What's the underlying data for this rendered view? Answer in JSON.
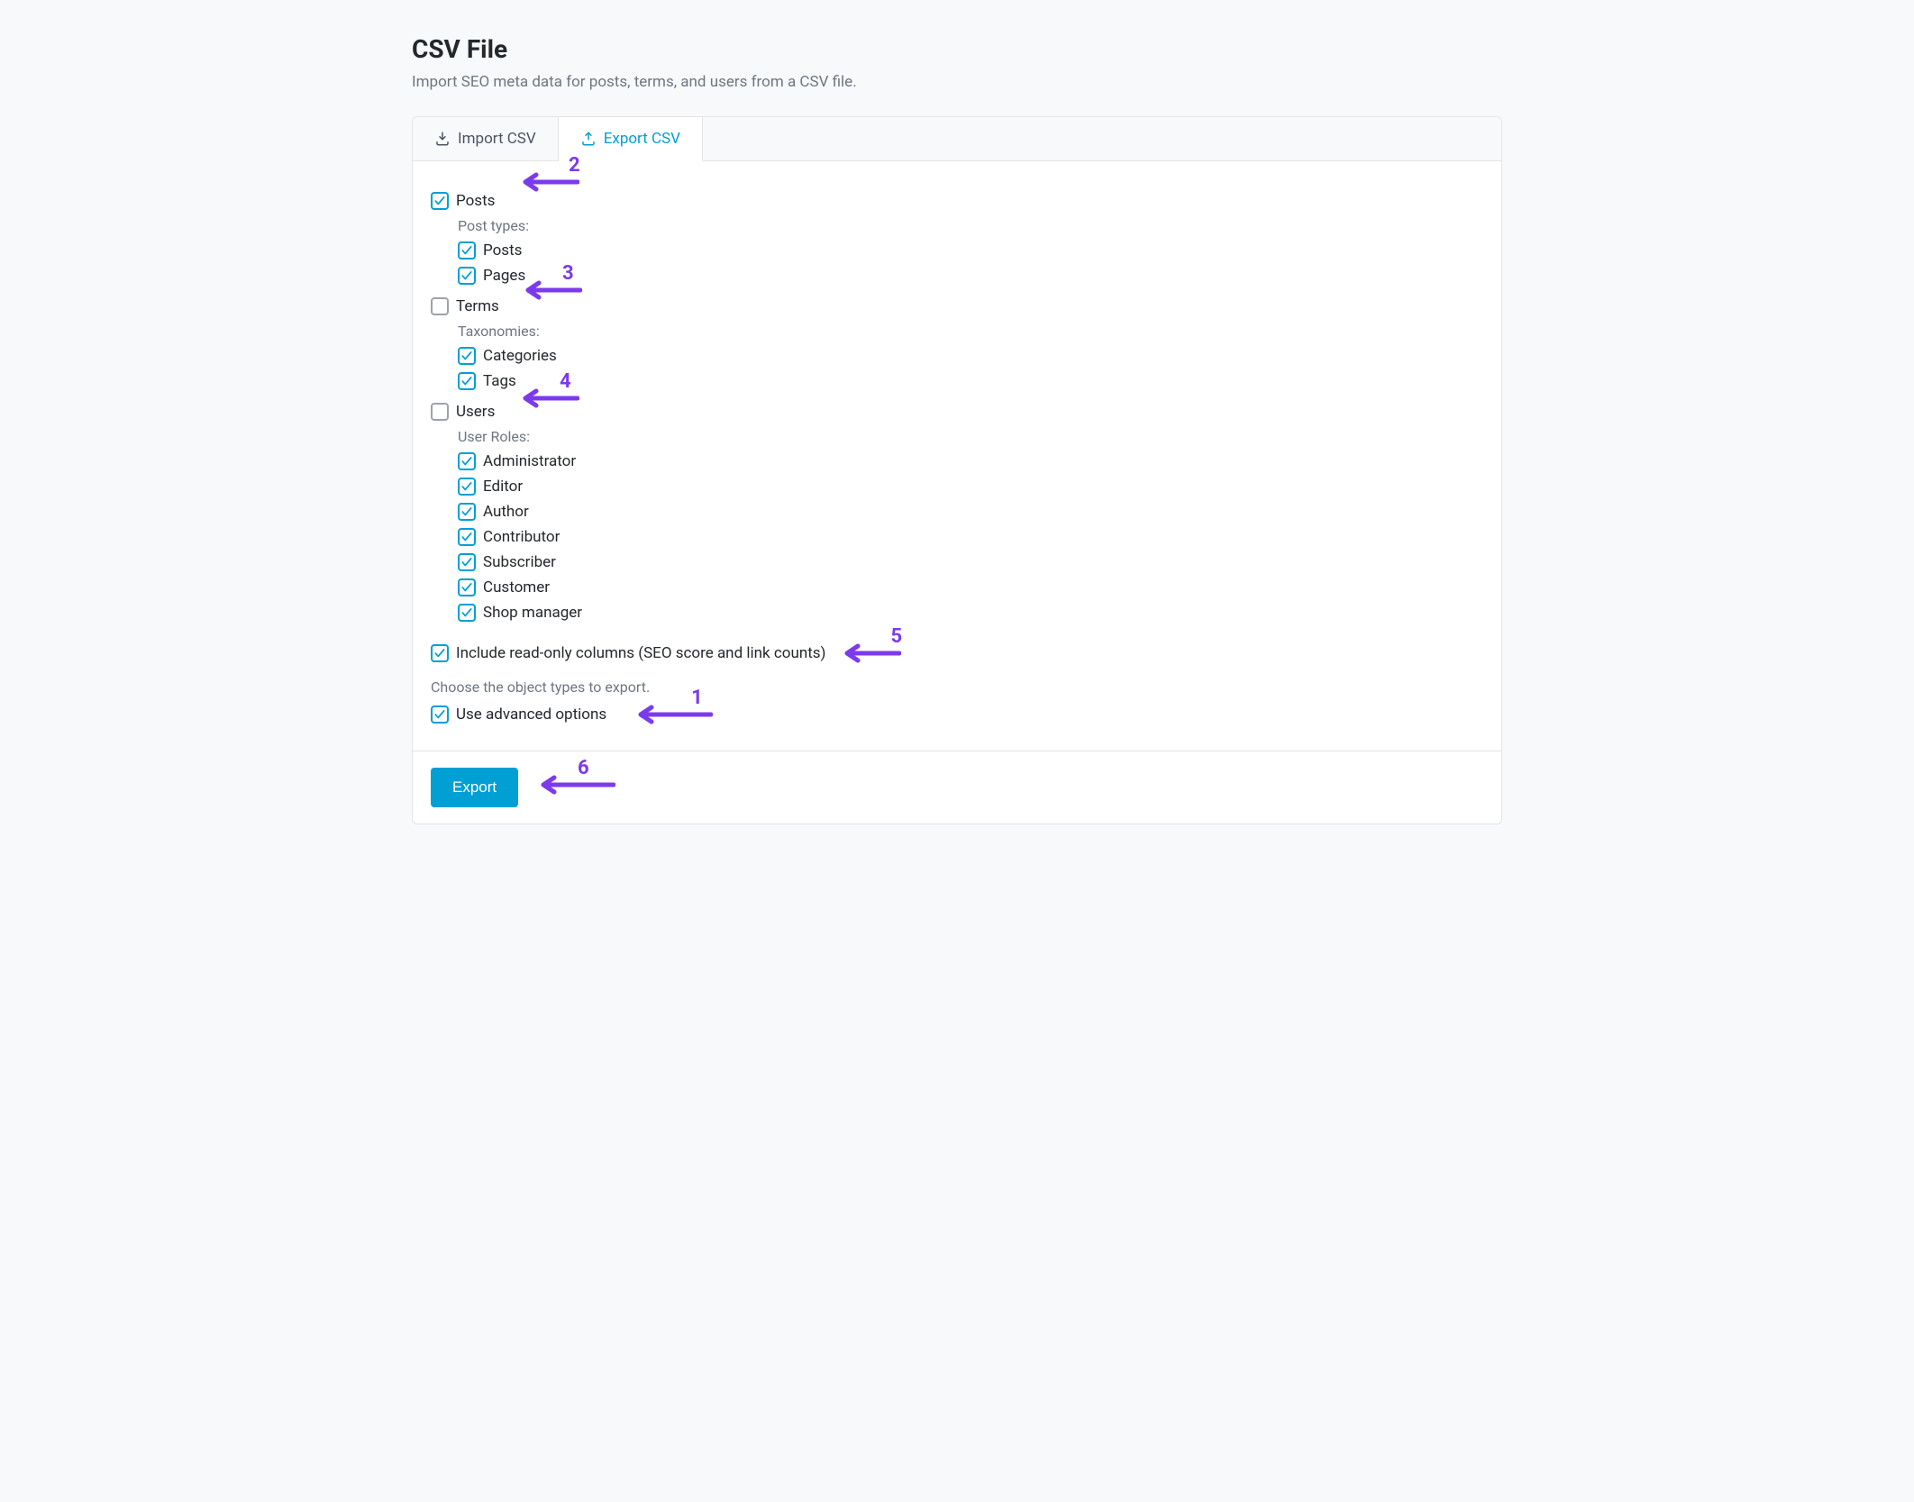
{
  "header": {
    "title": "CSV File",
    "description": "Import SEO meta data for posts, terms, and users from a CSV file."
  },
  "tabs": {
    "import": "Import CSV",
    "export": "Export CSV"
  },
  "sections": {
    "posts": {
      "label": "Posts",
      "subheading": "Post types:",
      "items": [
        "Posts",
        "Pages"
      ]
    },
    "terms": {
      "label": "Terms",
      "subheading": "Taxonomies:",
      "items": [
        "Categories",
        "Tags"
      ]
    },
    "users": {
      "label": "Users",
      "subheading": "User Roles:",
      "items": [
        "Administrator",
        "Editor",
        "Author",
        "Contributor",
        "Subscriber",
        "Customer",
        "Shop manager"
      ]
    }
  },
  "options": {
    "include_readonly": "Include read-only columns (SEO score and link counts)",
    "choose_note": "Choose the object types to export.",
    "use_advanced": "Use advanced options"
  },
  "actions": {
    "export": "Export"
  },
  "annotations": {
    "n1": "1",
    "n2": "2",
    "n3": "3",
    "n4": "4",
    "n5": "5",
    "n6": "6"
  },
  "colors": {
    "accent": "#009fd4",
    "annotation": "#7c3aed",
    "muted": "#6c7781"
  }
}
